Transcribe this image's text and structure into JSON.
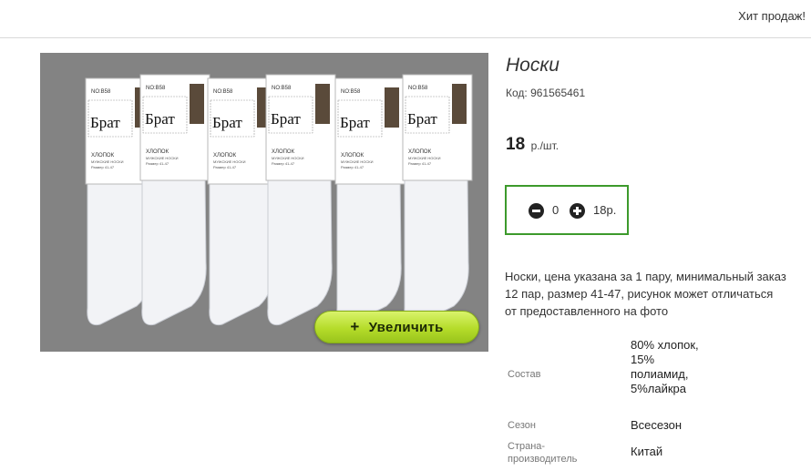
{
  "header": {
    "hit_link": "Хит продаж!"
  },
  "product": {
    "title": "Носки",
    "code": "Код: 961565461",
    "price": "18",
    "price_unit": "р./шт.",
    "quantity": "0",
    "sum": "18р.",
    "description": "Носки, цена указана за 1 пару, минимальный заказ 12 пар, размер 41-47, рисунок может отличаться от предоставленного на фото",
    "zoom_label": "Увеличить",
    "zoom_icon": "+"
  },
  "photo": {
    "label_brand": "Брат",
    "label_no": "NO:B58",
    "label_material": "ХЛОПОК",
    "label_kind": "МУЖСКИЕ НОСКИ",
    "label_size": "Размер 41-47"
  },
  "properties": [
    {
      "key": "Состав",
      "value": "80% хлопок, 15% полиамид, 5%лайкра"
    },
    {
      "key": "Сезон",
      "value": "Всесезон"
    },
    {
      "key": "Страна-производитель",
      "value": "Китай"
    }
  ],
  "icons": {
    "minus": "minus-circle-icon",
    "plus": "plus-circle-icon"
  },
  "colors": {
    "accent_border": "#3d9a2c",
    "zoom_button": "#b5dc2a",
    "photo_bg": "#838383"
  }
}
